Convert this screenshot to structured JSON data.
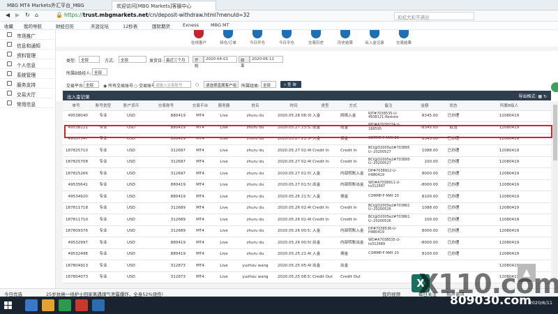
{
  "browser": {
    "tabs": [
      {
        "label": "MBG MT4 Markets外汇平台_MBG"
      },
      {
        "label": "欢迎访问[MBG Markets]客服中心"
      }
    ],
    "url_scheme": "https://",
    "url_host": "trust.mbgmarkets.net",
    "url_path": "/cn/deposit-withdraw.html?menuId=32",
    "search_placeholder": "彩虹大彩不满分"
  },
  "bookmarks": [
    "收藏",
    "我的导航",
    "财经日历",
    "天涯论坛",
    "12秒表",
    "国际期货",
    "Exness",
    "MBG MT"
  ],
  "sidebar": {
    "items": [
      {
        "label": "市场推广"
      },
      {
        "label": "信息和通知"
      },
      {
        "label": "资料管理"
      },
      {
        "label": "个人信息"
      },
      {
        "label": "系统管理"
      },
      {
        "label": "服务支持"
      },
      {
        "label": "交易大厅"
      },
      {
        "label": "常用信息"
      }
    ]
  },
  "quick_icons": [
    {
      "label": "在线客户"
    },
    {
      "label": "持仓/订单"
    },
    {
      "label": "今日开仓"
    },
    {
      "label": "今日平仓"
    },
    {
      "label": "交易历史"
    },
    {
      "label": "历史结算"
    },
    {
      "label": "出入金记录"
    },
    {
      "label": "交易结果"
    }
  ],
  "filters": {
    "type_label": "类型:",
    "type_value": "全部",
    "method_label": "方式:",
    "method_value": "全部",
    "date_label": "发货日:",
    "date_range": "最近三个月",
    "start_label": "开始",
    "start_date": "2020-04-01",
    "end_label": "结束",
    "end_date": "2020-06-11",
    "agent_label": "所属B级经人:",
    "agent_value": "全部",
    "platform_label": "交易平台:",
    "platform_value": "全部",
    "opt1": "所有交易账号",
    "opt2": "交易账号",
    "account_placeholder": "请输入交易账号",
    "direct_label": "请选择直属客户组",
    "server_label": "所属组类:",
    "server_value": "全部",
    "query_button": "查 询"
  },
  "panel": {
    "title": "出入金记录",
    "export_label": "导出格式:"
  },
  "table": {
    "headers": [
      "单号",
      "账号类型",
      "账户货币",
      "交易账号",
      "交易平台",
      "服务器",
      "姓名",
      "时间",
      "类型",
      "方式",
      "备注",
      "金额",
      "状态",
      "所属B级人"
    ],
    "rows": [
      [
        "49538040",
        "专业",
        "USD",
        "880419",
        "MT4",
        "Live",
        "zhuru du",
        "2020.05.28 08:38",
        "入金",
        "网络入金",
        "RJT#7038535-U-4938121-Restore",
        "8345.00",
        "已办理",
        "12080419"
      ],
      [
        "49538121",
        "专业",
        "USD",
        "880419",
        "MT4",
        "Live",
        "zhuru du",
        "2020.05.27 23:52",
        "出金",
        "出金",
        "WD#A7038274-U-188595",
        "-8345.00",
        "取消",
        "12080419"
      ],
      [
        "49537547",
        "专业",
        "USD",
        "880419",
        "MT4",
        "Live",
        "zhuru du",
        "2020.05.27 21:54",
        "入金",
        "佣金",
        "COMMP-F-MAY 20",
        "8345.00",
        "已办理",
        "12080419"
      ],
      [
        "187825710",
        "专业",
        "USD",
        "312697",
        "MT4",
        "Live",
        "zhuru du",
        "2020.05.27 02:46",
        "Credit In",
        "Credit In",
        "BCI@D2005e2#7038951-U--20200527",
        "1088.00",
        "已办理",
        "12080419"
      ],
      [
        "187825708",
        "专业",
        "USD",
        "312697",
        "MT4",
        "Live",
        "zhuru du",
        "2020.05.27 02:46",
        "Credit In",
        "Credit In",
        "BCI@D2005e2#7038950-U--20200527",
        "100.00",
        "已办理",
        "12080419"
      ],
      [
        "187825266",
        "专业",
        "USD",
        "312697",
        "MT4",
        "Live",
        "zhuru du",
        "2020.05.27 01:59",
        "入金",
        "内部转账入金",
        "DP#7038912-U-fr880419",
        "8000.00",
        "已办理",
        "12080419"
      ],
      [
        "49535641",
        "专业",
        "USD",
        "880419",
        "MT4",
        "Live",
        "zhuru du",
        "2020.05.27 01:59",
        "出金",
        "内部转账出金",
        "WD#A7038911-U-to312697",
        "-8000.00",
        "已办理",
        "12080419"
      ],
      [
        "49534920",
        "专业",
        "USD",
        "880419",
        "MT4",
        "Live",
        "zhuru du",
        "2020.05.26 21:53",
        "入金",
        "佣金",
        "COMMP-F-MAY 20",
        "8100.00",
        "已办理",
        "12080419"
      ],
      [
        "187811718",
        "专业",
        "USD",
        "312689",
        "MT4",
        "Live",
        "zhuru du",
        "2020.05.26 02:46",
        "Credit In",
        "Credit In",
        "BCI@D2005e2#7038619-U--20200526",
        "1088.00",
        "已办理",
        "12080419"
      ],
      [
        "187811710",
        "专业",
        "USD",
        "312689",
        "MT4",
        "Live",
        "zhuru du",
        "2020.05.26 02:46",
        "Credit In",
        "Credit In",
        "BCI@D2005e2#7038618-U--20200526",
        "100.00",
        "已办理",
        "12080419"
      ],
      [
        "187809376",
        "专业",
        "USD",
        "312689",
        "MT4",
        "Live",
        "zhuru du",
        "2020.05.26 00:51",
        "入金",
        "内部转账入金",
        "DP#7038536-U-fr880419",
        "8000.00",
        "已办理",
        "12080419"
      ],
      [
        "49532997",
        "专业",
        "USD",
        "880419",
        "MT4",
        "Live",
        "zhuru du",
        "2020.05.26 00:50",
        "出金",
        "内部转账出金",
        "WD#A7038535-U-to312689",
        "-8000.00",
        "已办理",
        "12080419"
      ],
      [
        "49532498",
        "专业",
        "USD",
        "880419",
        "MT4",
        "Live",
        "zhuru du",
        "2020.05.25 21:48",
        "入金",
        "佣金",
        "COMMP-F-MAY 20",
        "8100.00",
        "已办理",
        "12080419"
      ],
      [
        "187804913",
        "专业",
        "USD",
        "312873",
        "MT4",
        "Live",
        "yuzhou wang",
        "2020.05.25 05:48",
        "出金",
        "出金",
        "",
        "",
        "",
        "12080419"
      ],
      [
        "187804073",
        "专业",
        "USD",
        "312873",
        "MT4",
        "Live",
        "yuzhou wang",
        "2020.05.25 08:53",
        "Credit Out",
        "Credit Out",
        "",
        "",
        "",
        "12080419"
      ]
    ]
  },
  "status_bar": {
    "left": "今日优选",
    "news": "25岁抗癌一线护士回家离遇煤气泄露爆炸，全身52%烧伤!",
    "video": "我的视频",
    "hot": "每日关注",
    "hotspot": "热点资讯"
  },
  "taskbar": {
    "time": "2020/6/11"
  },
  "watermark": {
    "brand": "X110.com",
    "site": "809030.com"
  }
}
